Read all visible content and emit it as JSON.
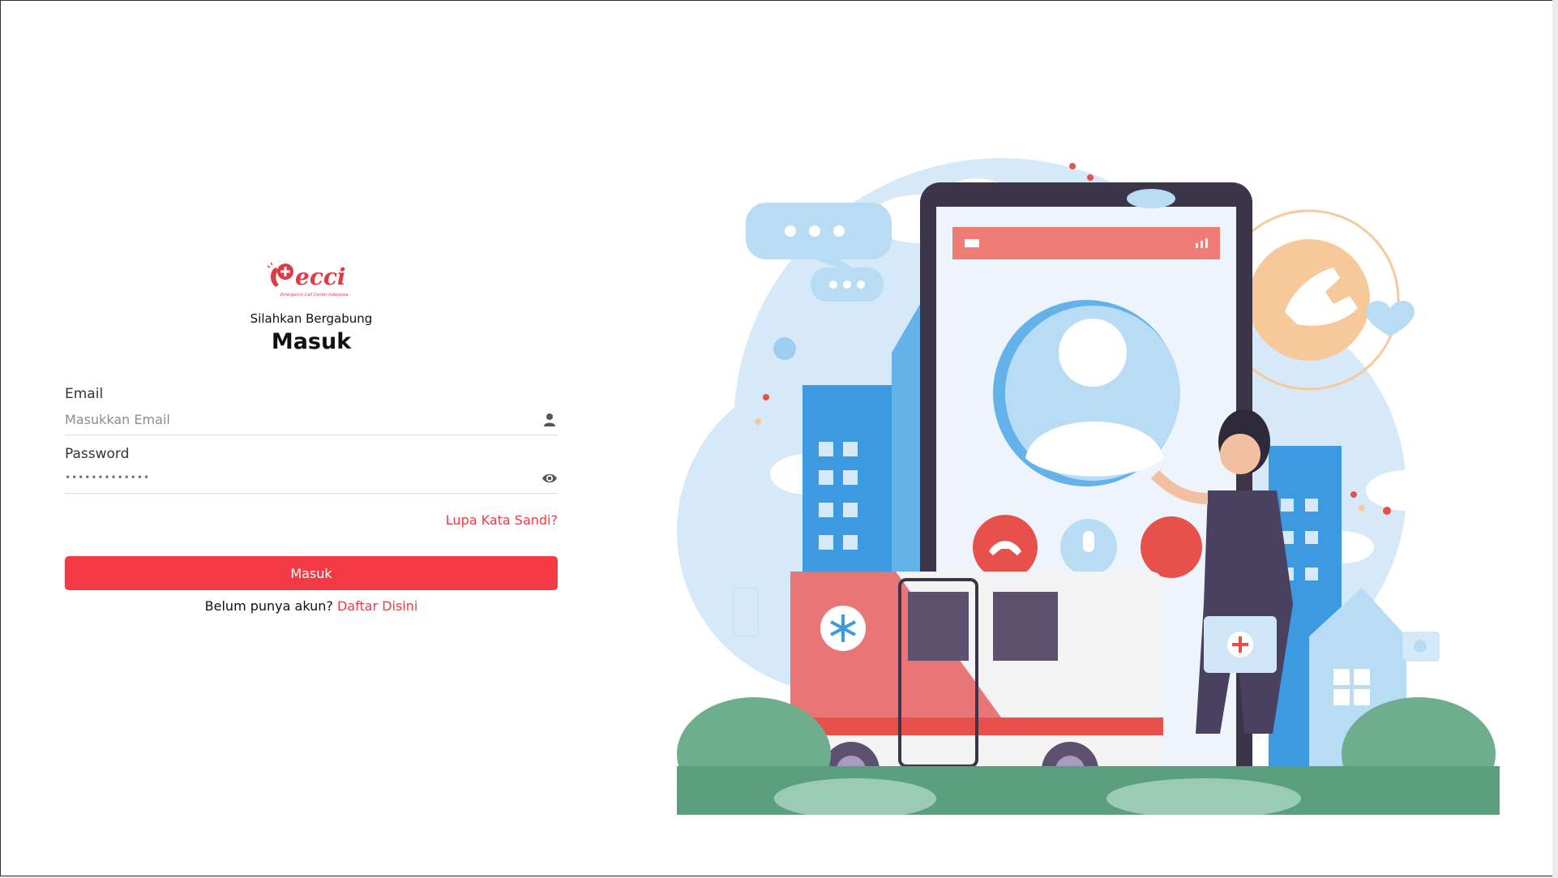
{
  "brand": {
    "logo_text": "ecci",
    "logo_tagline": "Emergency Call Center Indonesia",
    "accent": "#f43a45",
    "link_color": "#f13a44"
  },
  "login": {
    "welcome": "Silahkan Bergabung",
    "title": "Masuk",
    "email": {
      "label": "Email",
      "placeholder": "Masukkan Email",
      "value": "",
      "icon": "user-icon"
    },
    "password": {
      "label": "Password",
      "value": "•••••••••••••",
      "icon": "eye-icon"
    },
    "forgot_label": "Lupa Kata Sandi?",
    "submit_label": "Masuk",
    "register_prompt": "Belum punya akun?",
    "register_link": "Daftar Disini"
  },
  "illustration": {
    "subject": "emergency-call-ambulance-illustration"
  }
}
